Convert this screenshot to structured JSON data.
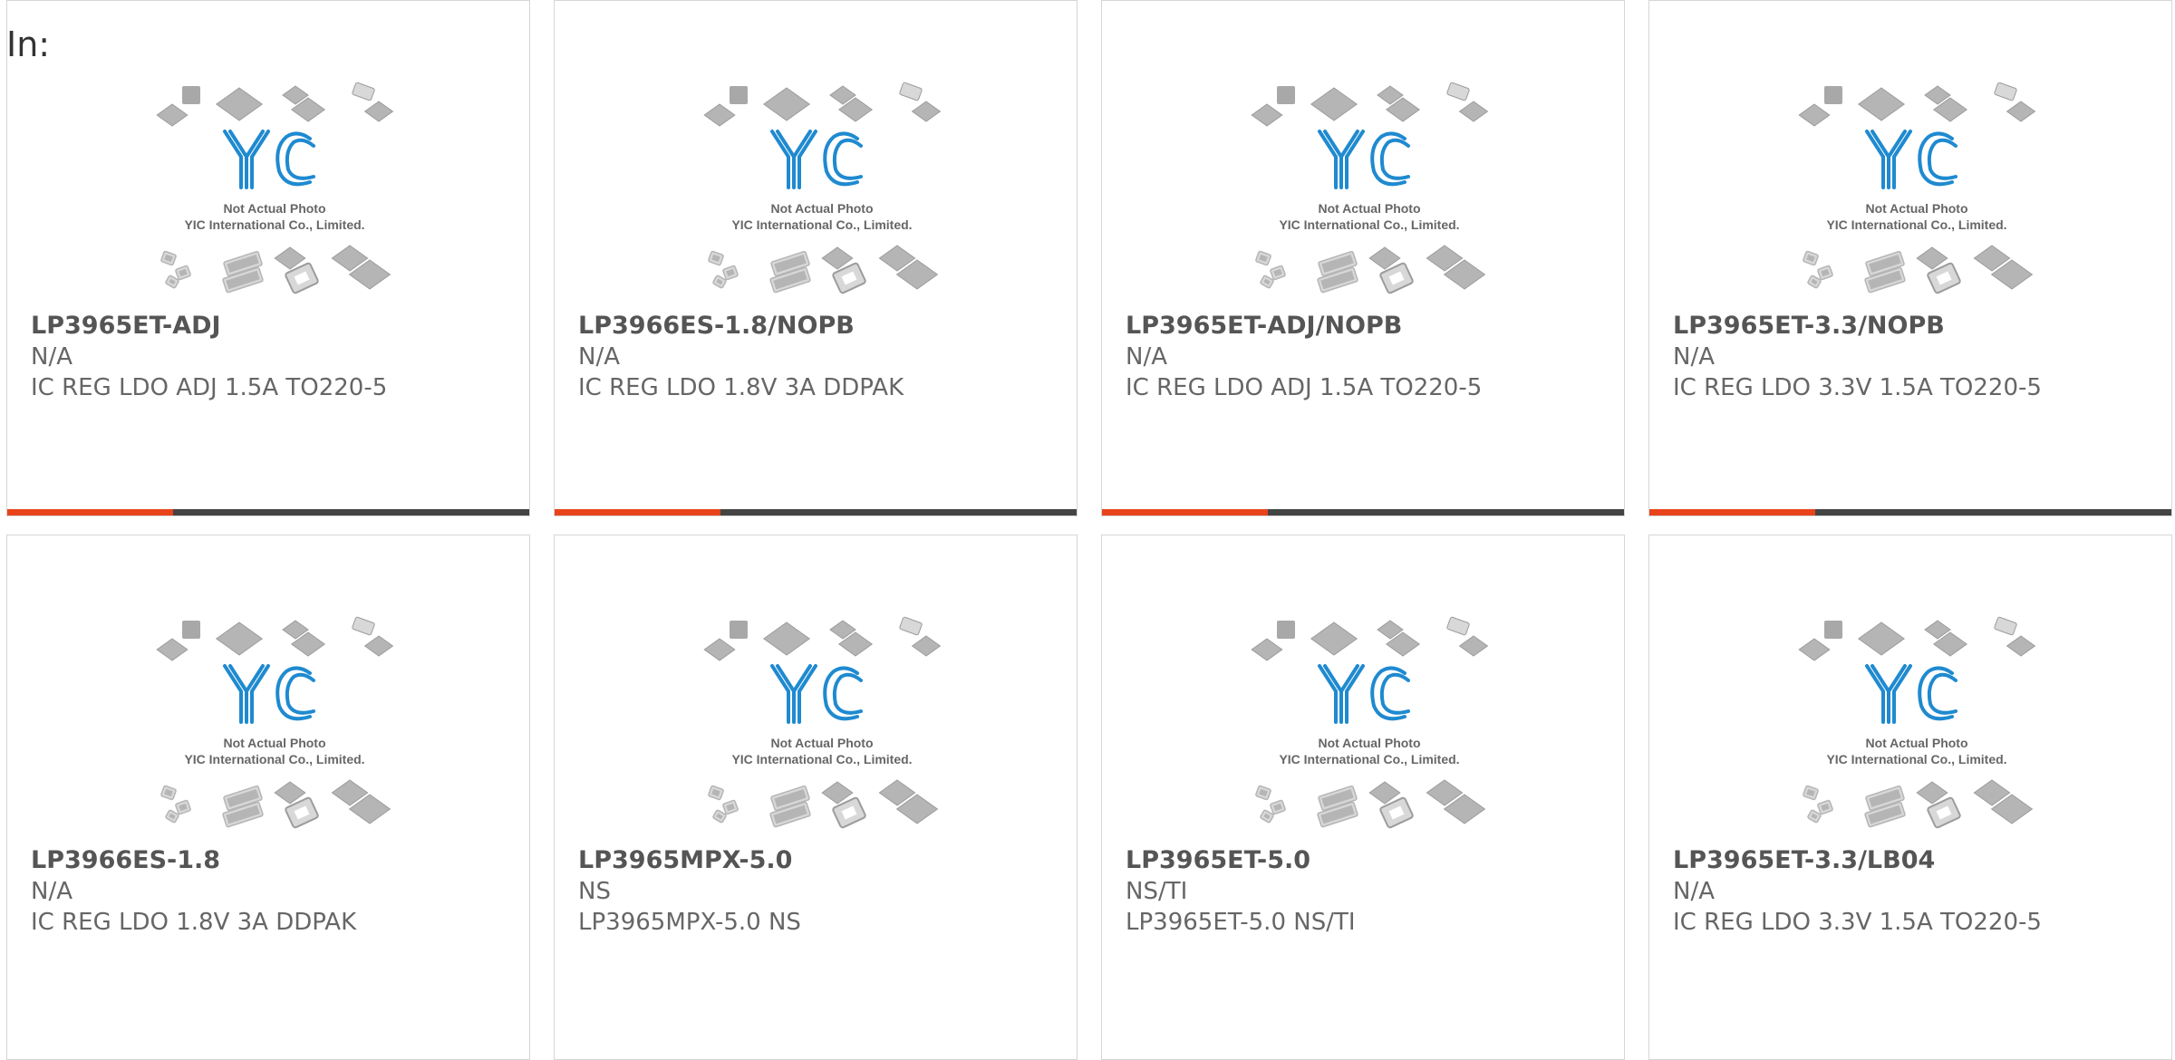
{
  "header": {
    "label": "In:"
  },
  "placeholder_image": {
    "caption_line1": "Not Actual Photo",
    "caption_line2": "YIC International Co., Limited.",
    "logo_text": "YIC"
  },
  "colors": {
    "accent": "#e8431b",
    "bar": "#444444",
    "logo_blue": "#1f8ad0"
  },
  "products": [
    {
      "part_number": "LP3965ET-ADJ",
      "manufacturer": "N/A",
      "description": "IC REG LDO ADJ 1.5A TO220-5"
    },
    {
      "part_number": "LP3966ES-1.8/NOPB",
      "manufacturer": "N/A",
      "description": "IC REG LDO 1.8V 3A DDPAK"
    },
    {
      "part_number": "LP3965ET-ADJ/NOPB",
      "manufacturer": "N/A",
      "description": "IC REG LDO ADJ 1.5A TO220-5"
    },
    {
      "part_number": "LP3965ET-3.3/NOPB",
      "manufacturer": "N/A",
      "description": "IC REG LDO 3.3V 1.5A TO220-5"
    },
    {
      "part_number": "LP3966ES-1.8",
      "manufacturer": "N/A",
      "description": "IC REG LDO 1.8V 3A DDPAK"
    },
    {
      "part_number": "LP3965MPX-5.0",
      "manufacturer": "NS",
      "description": "LP3965MPX-5.0 NS"
    },
    {
      "part_number": "LP3965ET-5.0",
      "manufacturer": "NS/TI",
      "description": "LP3965ET-5.0 NS/TI"
    },
    {
      "part_number": "LP3965ET-3.3/LB04",
      "manufacturer": "N/A",
      "description": "IC REG LDO 3.3V 1.5A TO220-5"
    }
  ]
}
